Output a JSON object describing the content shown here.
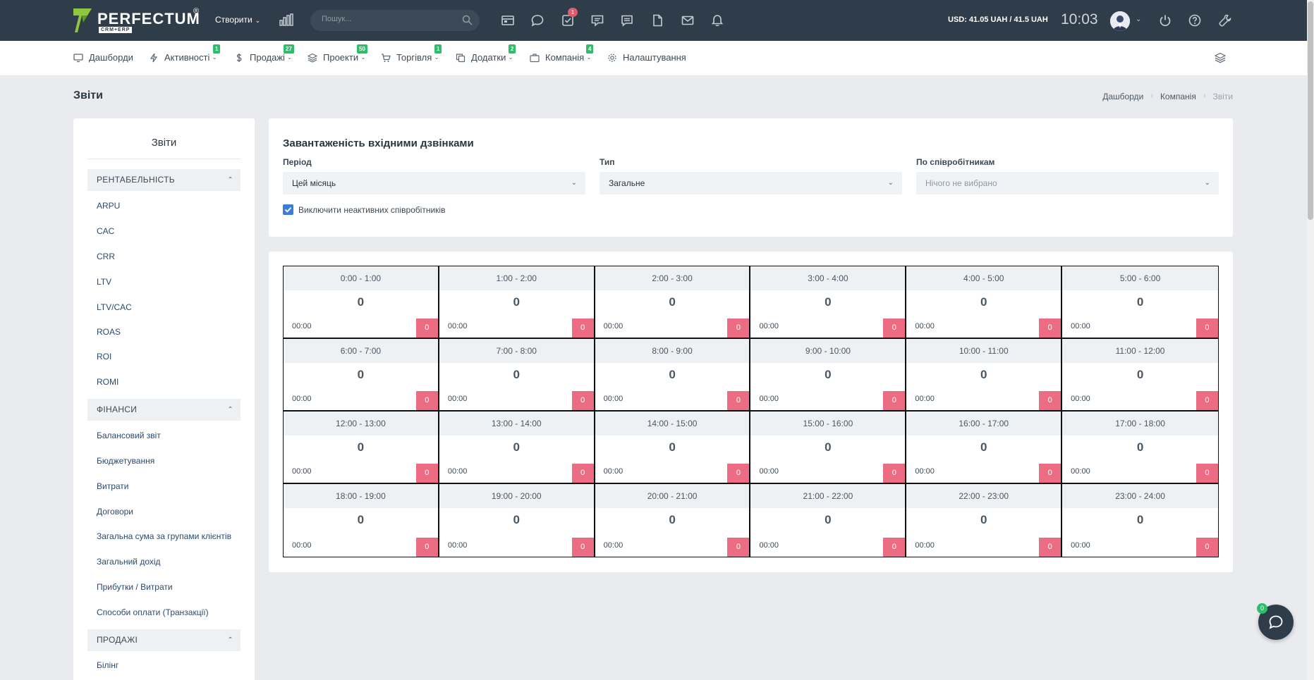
{
  "topbar": {
    "logo_text": "PERFECTUM",
    "logo_reg": "®",
    "logo_sub": "CRM+ERP",
    "create_label": "Створити",
    "search_placeholder": "Пошук...",
    "tasks_badge": "1",
    "currency": "USD: 41.05 UAH / 41.5 UAH",
    "time": "10:03"
  },
  "nav": [
    {
      "label": "Дашборди",
      "icon": "monitor-icon",
      "badge": ""
    },
    {
      "label": "Активності",
      "icon": "bolt-icon",
      "badge": "1"
    },
    {
      "label": "Продажі",
      "icon": "dollar-icon",
      "badge": "27"
    },
    {
      "label": "Проекти",
      "icon": "layers-icon",
      "badge": "50"
    },
    {
      "label": "Торгівля",
      "icon": "cart-icon",
      "badge": "1"
    },
    {
      "label": "Додатки",
      "icon": "copy-icon",
      "badge": "2"
    },
    {
      "label": "Компанія",
      "icon": "briefcase-icon",
      "badge": "4"
    },
    {
      "label": "Налаштування",
      "icon": "gear-icon",
      "badge": ""
    }
  ],
  "page": {
    "title": "Звіти",
    "breadcrumb": [
      "Дашборди",
      "Компанія",
      "Звіти"
    ]
  },
  "sidebar": {
    "title": "Звіти",
    "sections": [
      {
        "title": "РЕНТАБЕЛЬНІСТЬ",
        "items": [
          "ARPU",
          "CAC",
          "CRR",
          "LTV",
          "LTV/CAC",
          "ROAS",
          "ROI",
          "ROMI"
        ]
      },
      {
        "title": "ФІНАНСИ",
        "items": [
          "Балансовий звіт",
          "Бюджетування",
          "Витрати",
          "Договори",
          "Загальна сума за групами клієнтів",
          "Загальний дохід",
          "Прибутки / Витрати",
          "Способи оплати (Транзакції)"
        ]
      },
      {
        "title": "ПРОДАЖІ",
        "items": [
          "Білінг"
        ]
      }
    ]
  },
  "filters": {
    "title": "Завантаженість вхідними дзвінками",
    "period_label": "Період",
    "period_value": "Цей місяць",
    "type_label": "Тип",
    "type_value": "Загальне",
    "staff_label": "По співробітникам",
    "staff_placeholder": "Нічого не вибрано",
    "exclude_inactive_label": "Виключити неактивних співробітників",
    "exclude_inactive_checked": true
  },
  "hours": [
    {
      "range": "0:00 - 1:00",
      "count": "0",
      "duration": "00:00",
      "badge": "0"
    },
    {
      "range": "1:00 - 2:00",
      "count": "0",
      "duration": "00:00",
      "badge": "0"
    },
    {
      "range": "2:00 - 3:00",
      "count": "0",
      "duration": "00:00",
      "badge": "0"
    },
    {
      "range": "3:00 - 4:00",
      "count": "0",
      "duration": "00:00",
      "badge": "0"
    },
    {
      "range": "4:00 - 5:00",
      "count": "0",
      "duration": "00:00",
      "badge": "0"
    },
    {
      "range": "5:00 - 6:00",
      "count": "0",
      "duration": "00:00",
      "badge": "0"
    },
    {
      "range": "6:00 - 7:00",
      "count": "0",
      "duration": "00:00",
      "badge": "0"
    },
    {
      "range": "7:00 - 8:00",
      "count": "0",
      "duration": "00:00",
      "badge": "0"
    },
    {
      "range": "8:00 - 9:00",
      "count": "0",
      "duration": "00:00",
      "badge": "0"
    },
    {
      "range": "9:00 - 10:00",
      "count": "0",
      "duration": "00:00",
      "badge": "0"
    },
    {
      "range": "10:00 - 11:00",
      "count": "0",
      "duration": "00:00",
      "badge": "0"
    },
    {
      "range": "11:00 - 12:00",
      "count": "0",
      "duration": "00:00",
      "badge": "0"
    },
    {
      "range": "12:00 - 13:00",
      "count": "0",
      "duration": "00:00",
      "badge": "0"
    },
    {
      "range": "13:00 - 14:00",
      "count": "0",
      "duration": "00:00",
      "badge": "0"
    },
    {
      "range": "14:00 - 15:00",
      "count": "0",
      "duration": "00:00",
      "badge": "0"
    },
    {
      "range": "15:00 - 16:00",
      "count": "0",
      "duration": "00:00",
      "badge": "0"
    },
    {
      "range": "16:00 - 17:00",
      "count": "0",
      "duration": "00:00",
      "badge": "0"
    },
    {
      "range": "17:00 - 18:00",
      "count": "0",
      "duration": "00:00",
      "badge": "0"
    },
    {
      "range": "18:00 - 19:00",
      "count": "0",
      "duration": "00:00",
      "badge": "0"
    },
    {
      "range": "19:00 - 20:00",
      "count": "0",
      "duration": "00:00",
      "badge": "0"
    },
    {
      "range": "20:00 - 21:00",
      "count": "0",
      "duration": "00:00",
      "badge": "0"
    },
    {
      "range": "21:00 - 22:00",
      "count": "0",
      "duration": "00:00",
      "badge": "0"
    },
    {
      "range": "22:00 - 23:00",
      "count": "0",
      "duration": "00:00",
      "badge": "0"
    },
    {
      "range": "23:00 - 24:00",
      "count": "0",
      "duration": "00:00",
      "badge": "0"
    }
  ],
  "chat": {
    "badge": "0"
  },
  "colors": {
    "topbar": "#2f3d4a",
    "badge_green": "#2ebd6b",
    "badge_pink": "#ec6d83",
    "checkbox": "#3b7ed6"
  }
}
